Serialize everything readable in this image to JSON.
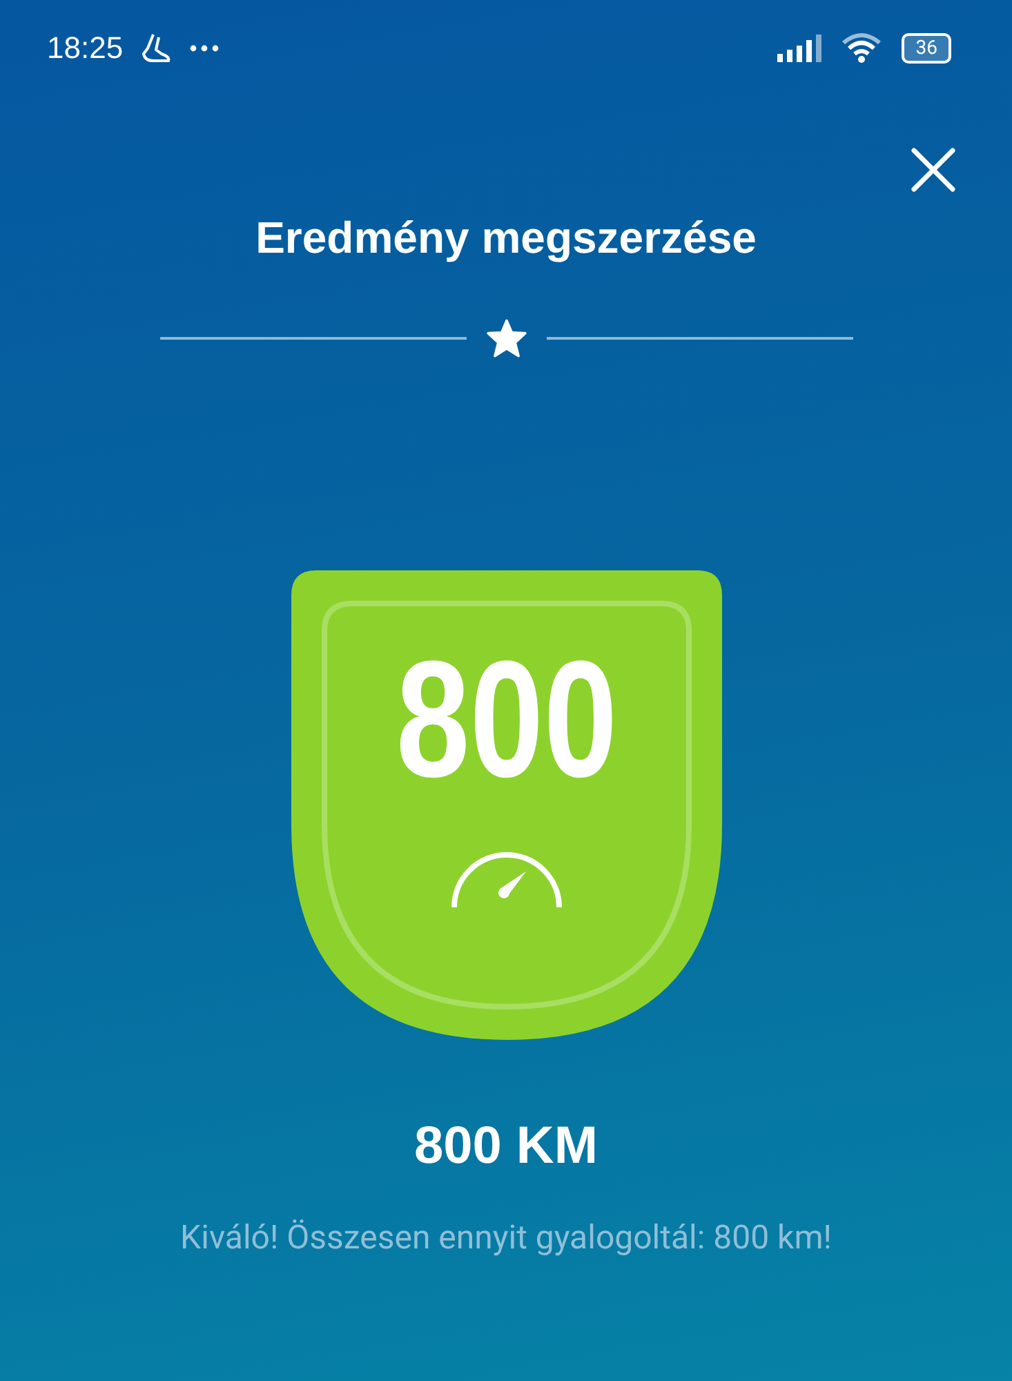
{
  "status_bar": {
    "time": "18:25",
    "battery": "36"
  },
  "title": "Eredmény megszerzése",
  "badge": {
    "number": "800"
  },
  "achievement": "800 KM",
  "description": "Kiváló! Összesen ennyit gyalogoltál: 800 km!"
}
